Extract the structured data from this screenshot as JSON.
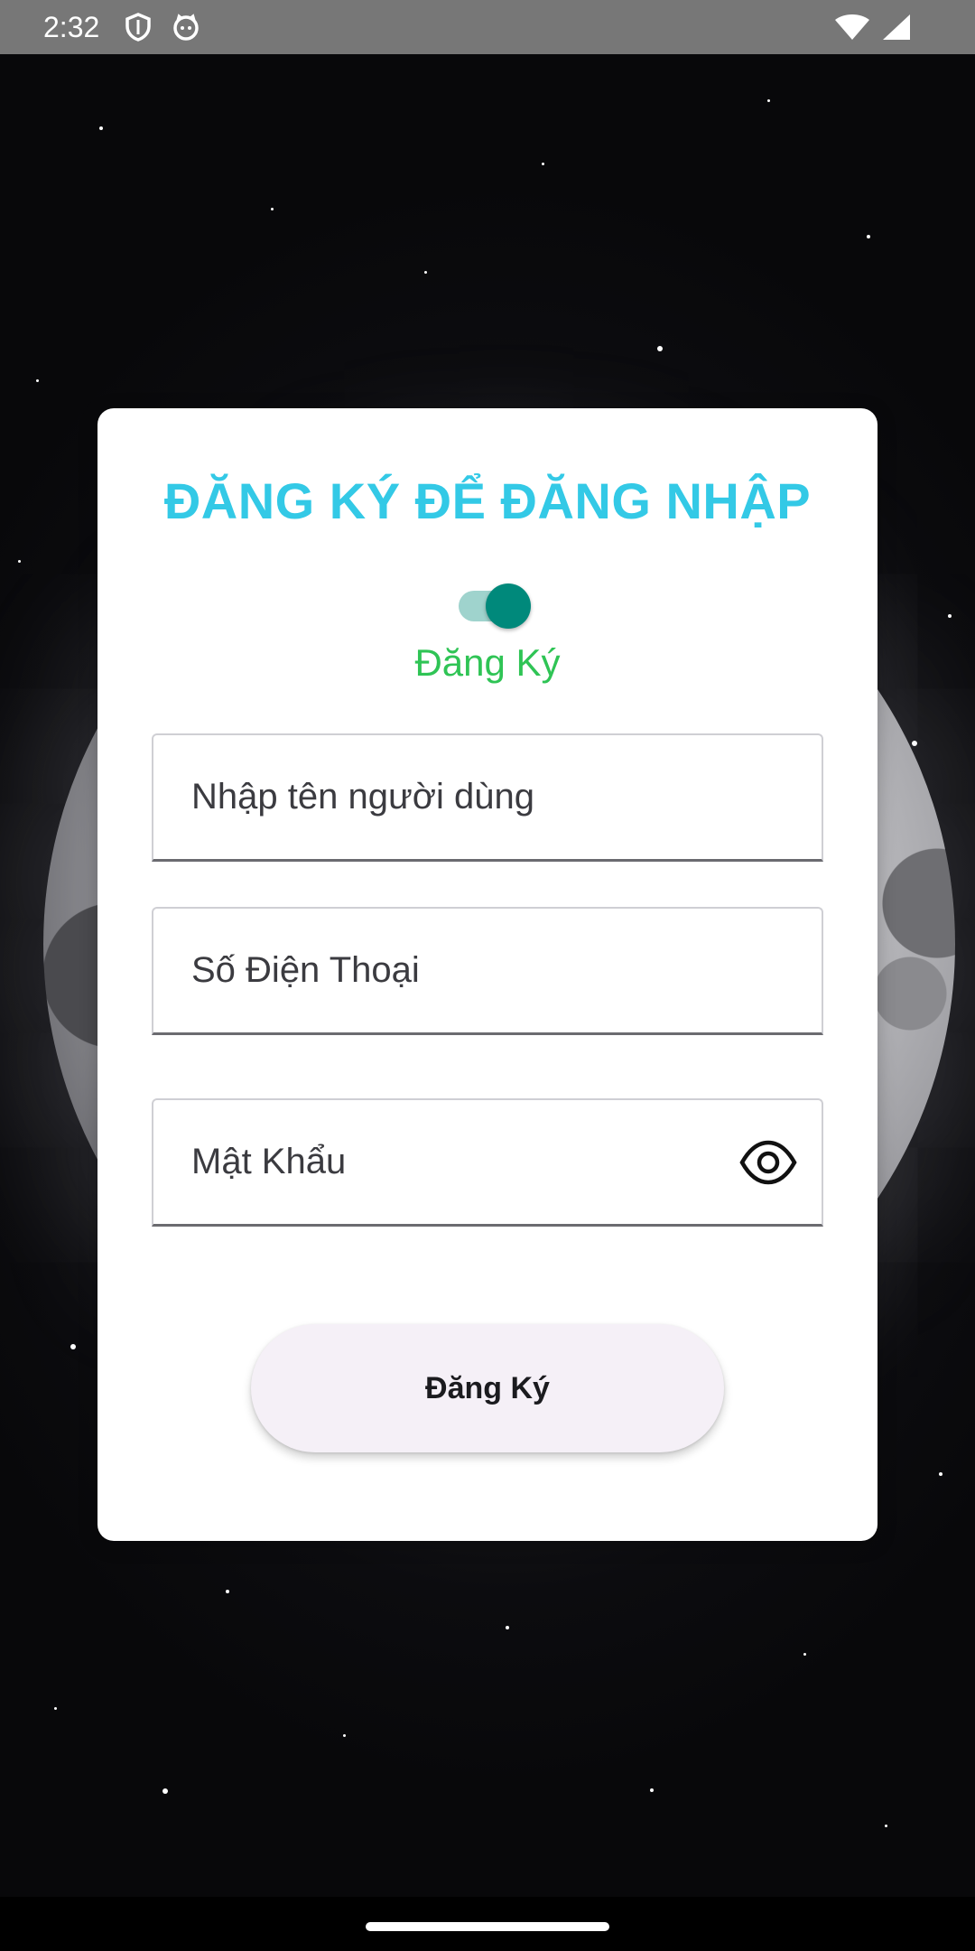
{
  "status_bar": {
    "time": "2:32",
    "icons": [
      "shield-icon",
      "cat-face-icon",
      "wifi-icon",
      "cellular-signal-icon"
    ]
  },
  "background": {
    "description_icon": "moon-icon"
  },
  "card": {
    "title": "ĐĂNG KÝ ĐỂ ĐĂNG NHẬP",
    "title_color": "#33c9e6",
    "mode_switch": {
      "checked": true,
      "label": "Đăng Ký",
      "label_color": "#2fc455",
      "thumb_color": "#00897b"
    },
    "fields": {
      "username": {
        "placeholder": "Nhập tên người dùng",
        "value": ""
      },
      "phone": {
        "placeholder": "Số Điện Thoại",
        "value": ""
      },
      "password": {
        "placeholder": "Mật Khẩu",
        "value": "",
        "toggle_icon": "eye-icon"
      }
    },
    "submit_label": "Đăng Ký"
  }
}
